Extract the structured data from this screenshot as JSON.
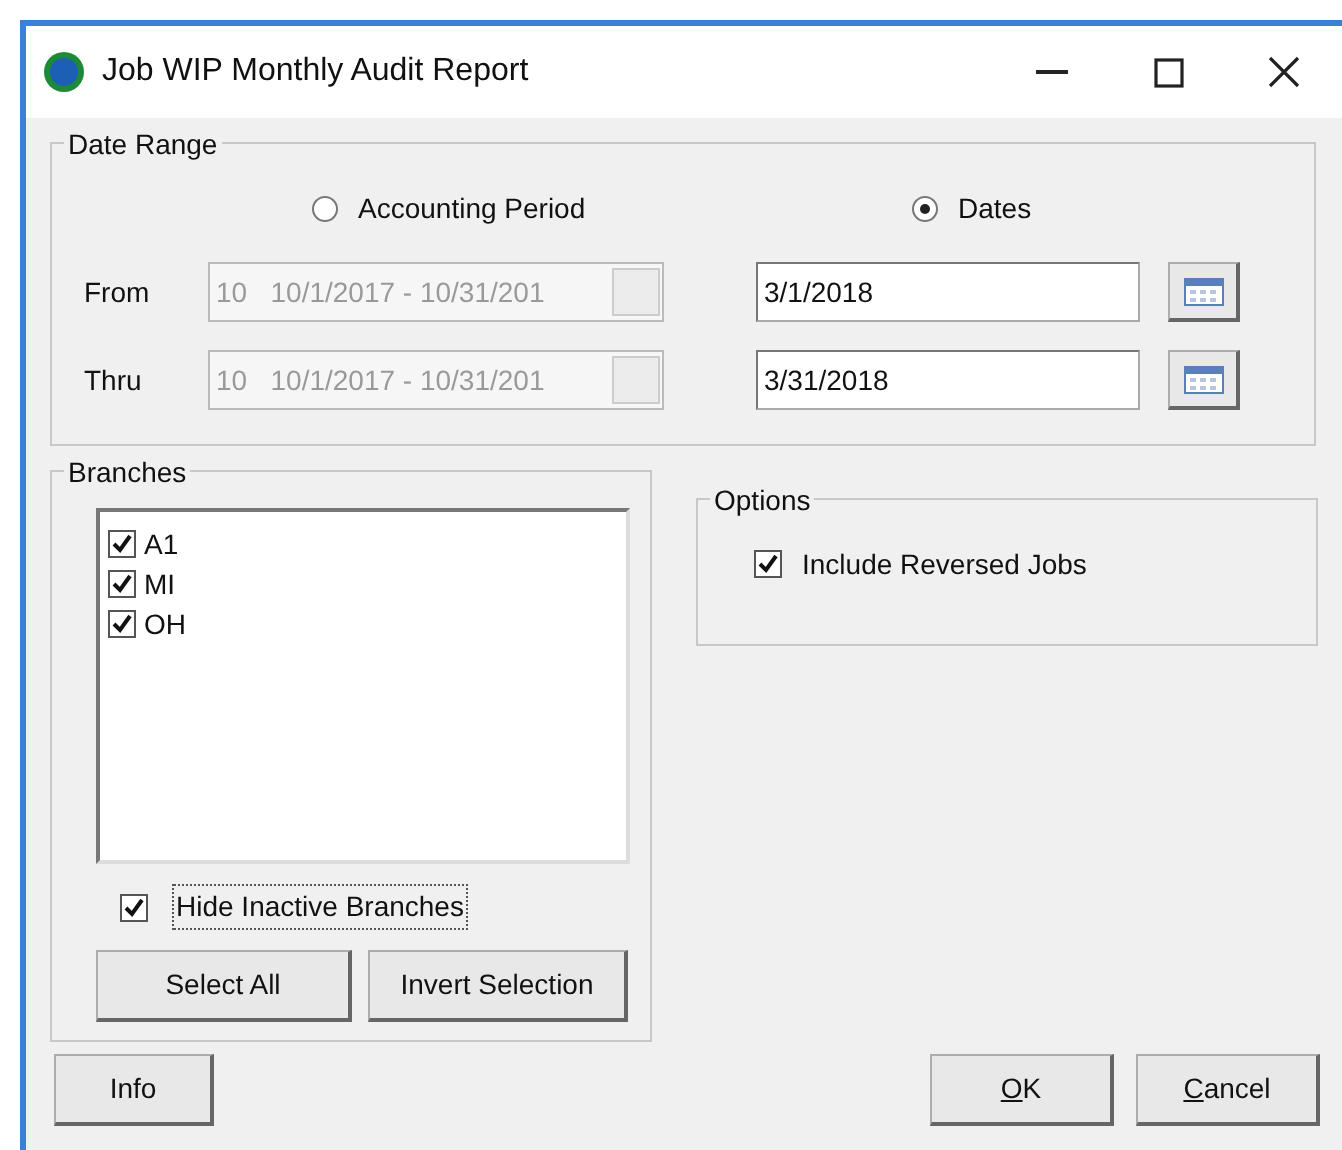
{
  "window": {
    "title": "Job WIP Monthly Audit Report"
  },
  "date_range": {
    "title": "Date Range",
    "modes": [
      {
        "label": "Accounting Period",
        "selected": false
      },
      {
        "label": "Dates",
        "selected": true
      }
    ],
    "rows": [
      {
        "label": "From",
        "period": "10   10/1/2017 - 10/31/201",
        "date": "3/1/2018"
      },
      {
        "label": "Thru",
        "period": "10   10/1/2017 - 10/31/201",
        "date": "3/31/2018"
      }
    ]
  },
  "branches": {
    "title": "Branches",
    "items": [
      {
        "label": "A1",
        "checked": true
      },
      {
        "label": "MI",
        "checked": true
      },
      {
        "label": "OH",
        "checked": true
      }
    ],
    "hide_inactive": {
      "label": "Hide Inactive Branches",
      "checked": true
    },
    "buttons": [
      "Select All",
      "Invert Selection"
    ]
  },
  "options": {
    "title": "Options",
    "items": [
      {
        "label": "Include Reversed Jobs",
        "checked": true
      }
    ]
  },
  "footer": {
    "left": [
      {
        "label": "Info"
      }
    ],
    "right": [
      {
        "label": "OK",
        "mnemonic_underlined": true
      },
      {
        "label": "Cancel",
        "mnemonic_underlined": true
      }
    ]
  }
}
